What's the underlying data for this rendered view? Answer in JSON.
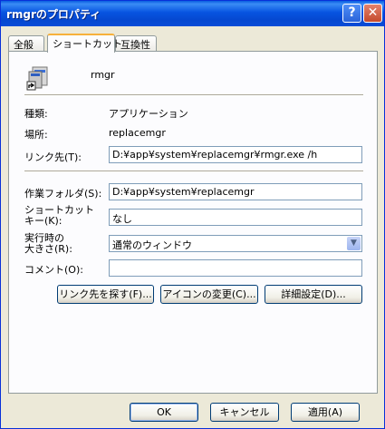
{
  "window": {
    "title": "rmgrのプロパティ",
    "help_glyph": "?",
    "close_glyph": "✕"
  },
  "tabs": [
    {
      "label": "全般"
    },
    {
      "label": "ショートカット"
    },
    {
      "label": "互換性"
    }
  ],
  "shortcut": {
    "name": "rmgr",
    "type_label": "種類:",
    "type_value": "アプリケーション",
    "location_label": "場所:",
    "location_value": "replacemgr",
    "target_label": "リンク先(T):",
    "target_value": "D:¥app¥system¥replacemgr¥rmgr.exe /h",
    "workdir_label": "作業フォルダ(S):",
    "workdir_value": "D:¥app¥system¥replacemgr",
    "hotkey_label_line1": "ショートカット",
    "hotkey_label_line2": "キー(K):",
    "hotkey_value": "なし",
    "run_label_line1": "実行時の",
    "run_label_line2": "大きさ(R):",
    "run_value": "通常のウィンドウ",
    "comment_label": "コメント(O):",
    "comment_value": ""
  },
  "buttons": {
    "find_target": "リンク先を探す(F)...",
    "change_icon": "アイコンの変更(C)...",
    "advanced": "詳細設定(D)...",
    "ok": "OK",
    "cancel": "キャンセル",
    "apply": "適用(A)"
  }
}
